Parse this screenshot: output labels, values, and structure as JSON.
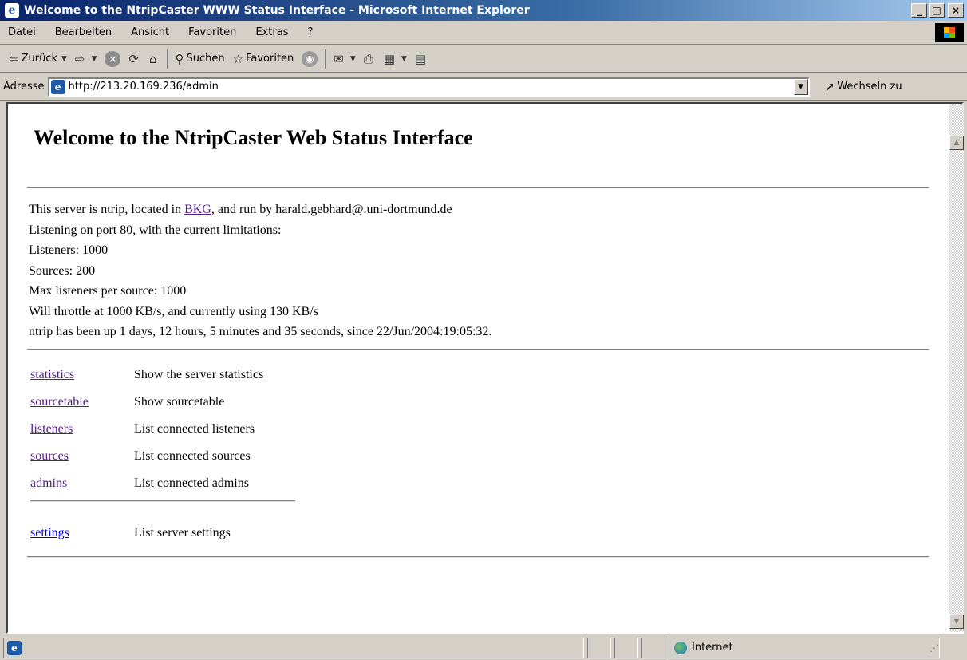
{
  "window": {
    "title": "Welcome to the NtripCaster WWW Status Interface - Microsoft Internet Explorer",
    "buttons": {
      "minimize": "_",
      "maximize": "□",
      "close": "×"
    }
  },
  "menu": [
    "Datei",
    "Bearbeiten",
    "Ansicht",
    "Favoriten",
    "Extras",
    "?"
  ],
  "toolbar": {
    "back_label": "Zurück",
    "search_label": "Suchen",
    "favorites_label": "Favoriten"
  },
  "address": {
    "label": "Adresse",
    "url": "http://213.20.169.236/admin",
    "go_label": "Wechseln zu"
  },
  "page": {
    "heading": "Welcome to the NtripCaster Web Status Interface",
    "server_line_prefix": "This server is ntrip, located in ",
    "server_location_link": "BKG",
    "server_line_suffix": ", and run by harald.gebhard@.uni-dortmund.de",
    "info_lines": [
      "Listening on port 80, with the current limitations:",
      "Listeners: 1000",
      "Sources: 200",
      "Max listeners per source: 1000",
      "Will throttle at 1000 KB/s, and currently using 130 KB/s",
      "ntrip has been up 1 days, 12 hours, 5 minutes and 35 seconds, since 22/Jun/2004:19:05:32."
    ],
    "links": [
      {
        "label": "statistics",
        "desc": "Show the server statistics"
      },
      {
        "label": "sourcetable",
        "desc": "Show sourcetable"
      },
      {
        "label": "listeners",
        "desc": "List connected listeners"
      },
      {
        "label": "sources",
        "desc": "List connected sources"
      },
      {
        "label": "admins",
        "desc": "List connected admins"
      }
    ],
    "settings_link": {
      "label": "settings",
      "desc": "List server settings"
    }
  },
  "status": {
    "zone": "Internet"
  }
}
